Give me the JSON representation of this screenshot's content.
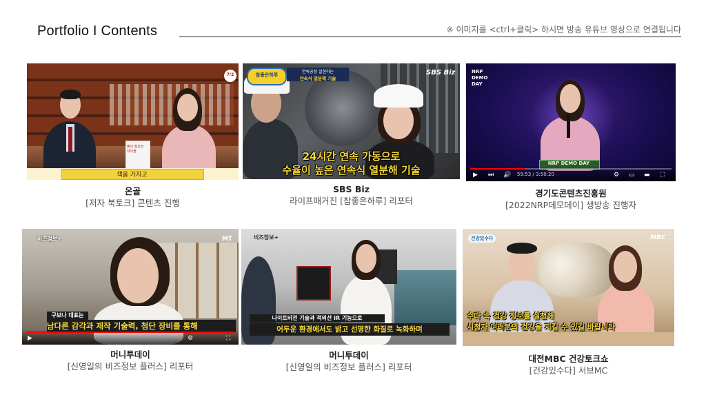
{
  "header": {
    "title": "Portfolio I Contents",
    "note": "※ 이미지를 <ctrl+클릭> 하시면 방송 유튜브 영상으로 연결됩니다"
  },
  "cards": [
    {
      "title": "온골",
      "subtitle": "[저자 북토크] 콘텐츠 진행",
      "banner": "책을 가지고",
      "badge": "7/2",
      "book_text": "빵이 필요한 아이들"
    },
    {
      "title": "SBS Biz",
      "subtitle": "라이프매거진 [참좋은하루] 리포터",
      "logo": "SBS Biz",
      "show_logo": "참좋은하루",
      "caption_top": "연속공정 실현하는",
      "caption_sub": "연속식 열분해 기술",
      "banner_line1": "24시간 연속 가동으로",
      "banner_line2": "수율이 높은 연속식 열분해 기술"
    },
    {
      "title": "경기도콘텐츠진흥원",
      "subtitle": "[2022NRP데모데이] 생방송 진행자",
      "corner_logo": "NRP DEMO DAY",
      "stage_sign": "NRP DEMO DAY",
      "time": "59:53 / 3:50:20"
    },
    {
      "title": "머니투데이",
      "subtitle": "[신영일의 비즈정보 플러스] 리포터",
      "show_logo": "비즈정보+",
      "corner": "MT",
      "banner_label": "구보나 대표는",
      "banner_line": "남다른 감각과 제작 기술력, 첨단 장비를 통해"
    },
    {
      "title": "머니투데이",
      "subtitle": "[신영일의 비즈정보 플러스] 리포터",
      "show_logo": "비즈정보+",
      "banner_line1": "나이트비전 기술과 적외선 IR 기능으로",
      "banner_line2": "어두운 환경에서도 밝고 선명한 화질로 녹화하며"
    },
    {
      "title": "대전MBC 건강토크쇼",
      "subtitle": "[건강있수다] 서브MC",
      "logo": "MBC",
      "show_logo": "건강있수다",
      "banner_line1": "수다 속 건강 정보를 실천해",
      "banner_line2": "시청자 여러분의 건강을 지킬 수 있길 바랍니다"
    }
  ],
  "colors": {
    "progress": "#ff0000",
    "banner_yellow": "#f5d83a",
    "banner_bg_dark": "#1d1d1d"
  }
}
